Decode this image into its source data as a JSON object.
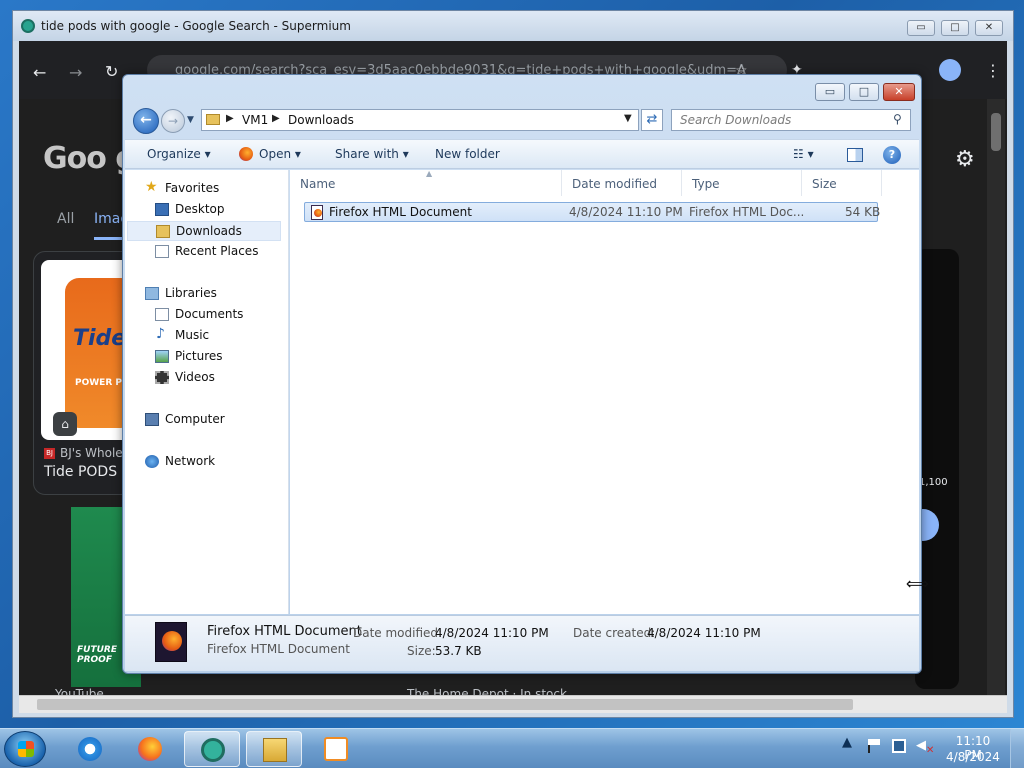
{
  "browser": {
    "title": "tide pods with google - Google Search - Supermium",
    "url": "google.com/search?sca_esv=3d5aac0ebbde9031&q=tide+pods+with+google&udm=A",
    "min_glyph": "▭",
    "max_glyph": "□",
    "close_glyph": "✕"
  },
  "google": {
    "logo_partial": "Goo gl",
    "tab_all": "All",
    "tab_images": "Imag",
    "card_source": "BJ's Wholes",
    "card_title": "Tide PODS H",
    "card_image_brand": "Tide",
    "card_image_sub": "POWER PODS",
    "card_tile2_text": "FUTURE PROOF",
    "result_count": "1,100",
    "bottom_link_1": "YouTube",
    "bottom_link_2": "The Home Depot · In stock"
  },
  "explorer": {
    "breadcrumb": [
      "VM1",
      "Downloads"
    ],
    "search_placeholder": "Search Downloads",
    "toolbar": {
      "organize": "Organize ▾",
      "open": "Open ▾",
      "share_with": "Share with ▾",
      "new_folder": "New folder",
      "views_glyph": "☷ ▾",
      "help_glyph": "?"
    },
    "nav": {
      "favorites": "Favorites",
      "desktop": "Desktop",
      "downloads": "Downloads",
      "recent_places": "Recent Places",
      "libraries": "Libraries",
      "documents": "Documents",
      "music": "Music",
      "pictures": "Pictures",
      "videos": "Videos",
      "computer": "Computer",
      "network": "Network"
    },
    "columns": {
      "name": "Name",
      "date_modified": "Date modified",
      "type": "Type",
      "size": "Size"
    },
    "files": [
      {
        "name": "Firefox HTML Document",
        "date_modified": "4/8/2024 11:10 PM",
        "type": "Firefox HTML Doc...",
        "size": "54 KB"
      }
    ],
    "details": {
      "name": "Firefox HTML Document",
      "type": "Firefox HTML Document",
      "date_modified_label": "Date modified:",
      "date_modified": "4/8/2024 11:10 PM",
      "size_label": "Size:",
      "size": "53.7 KB",
      "date_created_label": "Date created:",
      "date_created": "4/8/2024 11:10 PM"
    }
  },
  "taskbar": {
    "clock_time": "11:10 PM",
    "clock_date": "4/8/2024",
    "tray_arrow": "▲"
  },
  "icons": {
    "start": "windows-start-icon",
    "ie": "internet-explorer-icon",
    "firefox": "firefox-icon",
    "supermium": "supermium-icon",
    "explorer": "file-explorer-icon",
    "media": "media-player-icon"
  }
}
